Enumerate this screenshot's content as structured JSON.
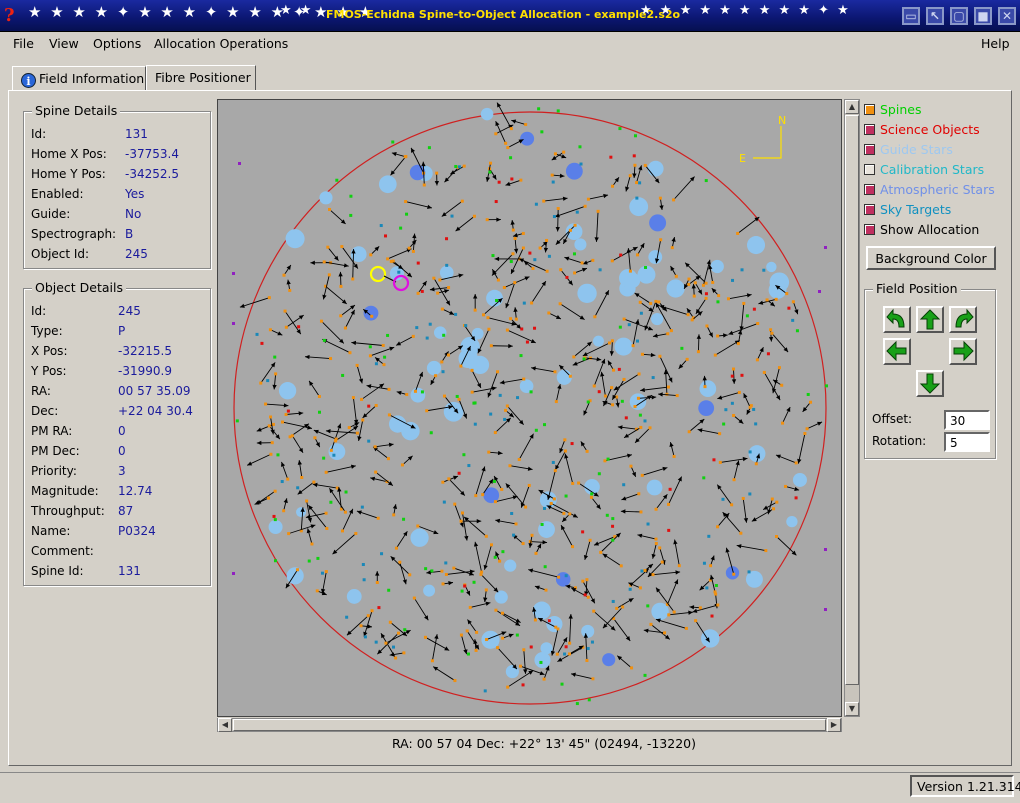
{
  "window": {
    "title": "FMOS-Echidna Spine-to-Object Allocation - example2.s2o"
  },
  "menu": {
    "file": "File",
    "view": "View",
    "options": "Options",
    "allocation": "Allocation Operations",
    "help": "Help"
  },
  "tabs": [
    {
      "label": "Field Information"
    },
    {
      "label": "Fibre Positioner"
    }
  ],
  "spine_details": {
    "title": "Spine Details",
    "rows": [
      {
        "label": "Id:",
        "value": "131"
      },
      {
        "label": "Home X Pos:",
        "value": "-37753.4"
      },
      {
        "label": "Home Y Pos:",
        "value": "-34252.5"
      },
      {
        "label": "Enabled:",
        "value": "Yes"
      },
      {
        "label": "Guide:",
        "value": "No"
      },
      {
        "label": "Spectrograph:",
        "value": "B"
      },
      {
        "label": "Object Id:",
        "value": "245"
      }
    ]
  },
  "object_details": {
    "title": "Object Details",
    "rows": [
      {
        "label": "Id:",
        "value": "245"
      },
      {
        "label": "Type:",
        "value": "P"
      },
      {
        "label": "X Pos:",
        "value": "-32215.5"
      },
      {
        "label": "Y Pos:",
        "value": "-31990.9"
      },
      {
        "label": "RA:",
        "value": "00 57 35.09"
      },
      {
        "label": "Dec:",
        "value": "+22 04 30.4"
      },
      {
        "label": "PM RA:",
        "value": "0"
      },
      {
        "label": "PM Dec:",
        "value": "0"
      },
      {
        "label": "Priority:",
        "value": "3"
      },
      {
        "label": "Magnitude:",
        "value": "12.74"
      },
      {
        "label": "Throughput:",
        "value": "87"
      },
      {
        "label": "Name:",
        "value": "P0324"
      },
      {
        "label": "Comment:",
        "value": ""
      },
      {
        "label": "Spine Id:",
        "value": "131"
      }
    ]
  },
  "compass": {
    "north": "N",
    "east": "E"
  },
  "status_coords": "RA: 00 57 04 Dec: +22° 13' 45\"     (02494, -13220)",
  "legend": [
    {
      "label": "Spines",
      "color": "#00d000",
      "box": "#f09010"
    },
    {
      "label": "Science Objects",
      "color": "#e00000",
      "box": "#c03060"
    },
    {
      "label": "Guide Stars",
      "color": "#9ec8f0",
      "box": "#c03060"
    },
    {
      "label": "Calibration Stars",
      "color": "#20b8c8",
      "box": "#e8e4dc"
    },
    {
      "label": "Atmospheric Stars",
      "color": "#7090e8",
      "box": "#c03060"
    },
    {
      "label": "Sky Targets",
      "color": "#1090c0",
      "box": "#c03060"
    },
    {
      "label": "Show Allocation",
      "color": "#000000",
      "box": "#c03060"
    }
  ],
  "background_button": "Background Color",
  "field_position": {
    "title": "Field Position",
    "offset_label": "Offset:",
    "offset_value": "30",
    "rotation_label": "Rotation:",
    "rotation_value": "5"
  },
  "version": "Version 1.21.314"
}
